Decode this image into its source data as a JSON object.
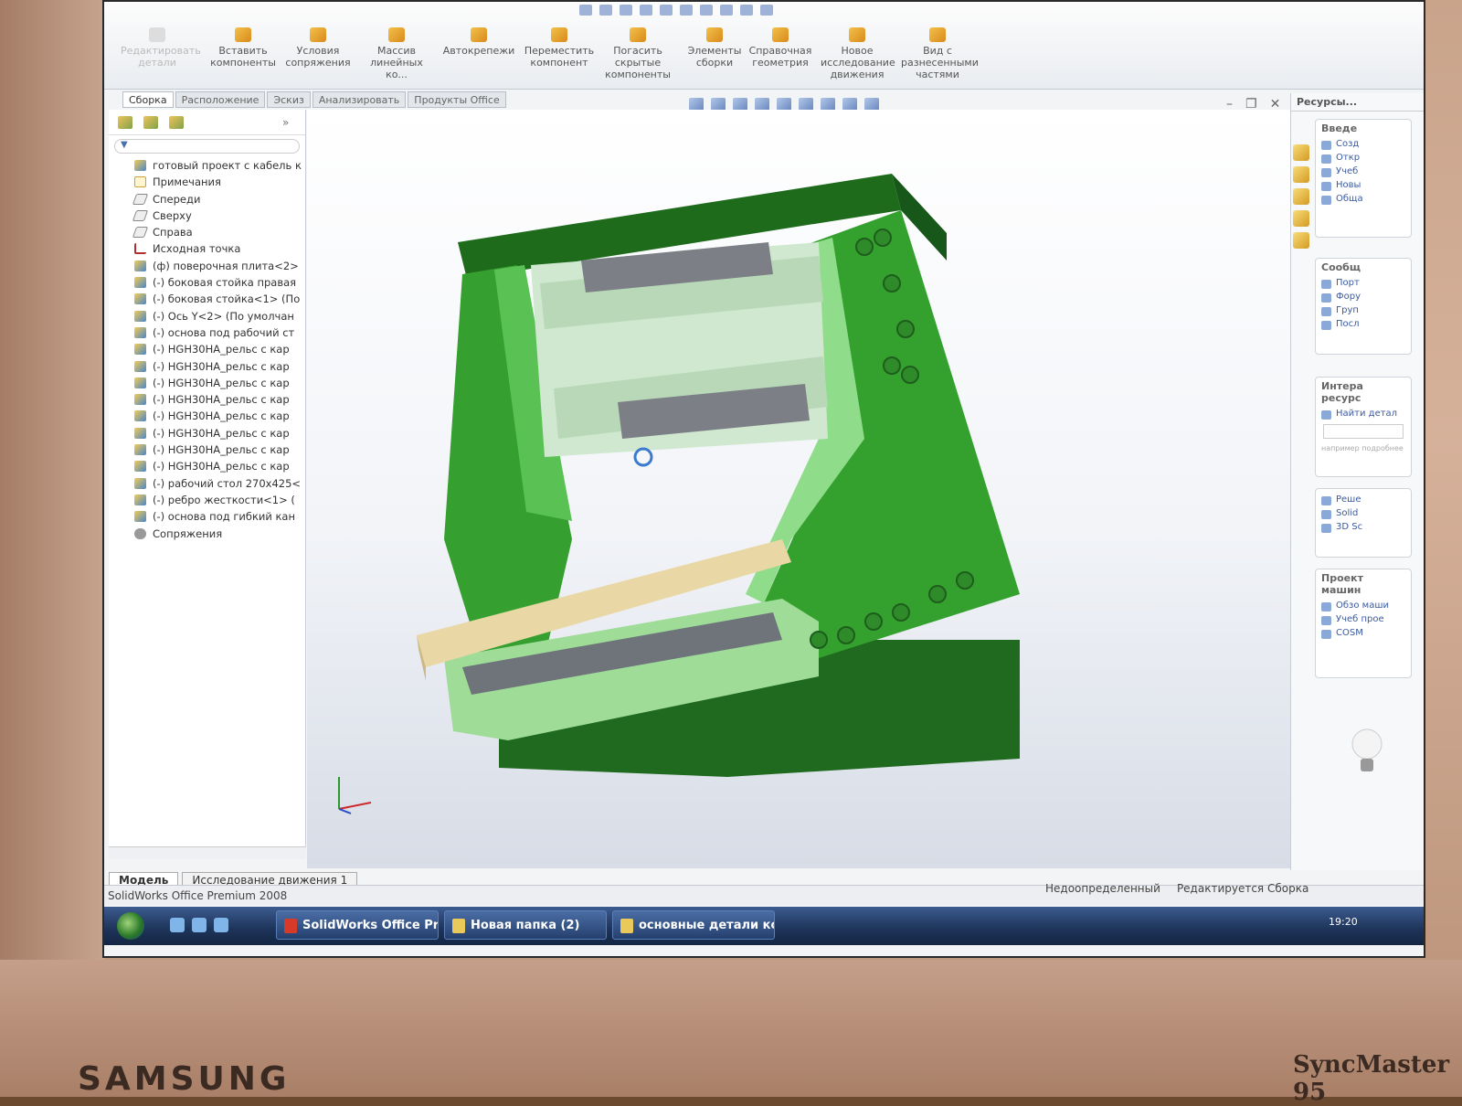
{
  "monitor": {
    "brand": "SAMSUNG",
    "model": "SyncMaster 95"
  },
  "ribbon": {
    "buttons": [
      {
        "label": "Редактировать детали",
        "dim": true
      },
      {
        "label": "Вставить компоненты"
      },
      {
        "label": "Условия сопряжения"
      },
      {
        "label": "Массив линейных ко..."
      },
      {
        "label": "Автокрепежи"
      },
      {
        "label": "Переместить компонент"
      },
      {
        "label": "Погасить скрытые компоненты"
      },
      {
        "label": "Элементы сборки"
      },
      {
        "label": "Справочная геометрия"
      },
      {
        "label": "Новое исследование движения"
      },
      {
        "label": "Вид с разнесенными частями"
      }
    ],
    "tabs": [
      "Сборка",
      "Расположение",
      "Эскиз",
      "Анализировать",
      "Продукты Office"
    ]
  },
  "tree": {
    "items": [
      {
        "label": "готовый проект с кабель к",
        "icon": "part"
      },
      {
        "label": "Примечания",
        "icon": "note"
      },
      {
        "label": "Спереди",
        "icon": "plane"
      },
      {
        "label": "Сверху",
        "icon": "plane"
      },
      {
        "label": "Справа",
        "icon": "plane"
      },
      {
        "label": "Исходная точка",
        "icon": "origin"
      },
      {
        "label": "(ф) поверочная плита<2>",
        "icon": "part"
      },
      {
        "label": "(-) боковая стойка правая",
        "icon": "part"
      },
      {
        "label": "(-) боковая стойка<1> (По",
        "icon": "part"
      },
      {
        "label": "(-) Ось Y<2> (По умолчан",
        "icon": "part"
      },
      {
        "label": "(-) основа под рабочий ст",
        "icon": "part"
      },
      {
        "label": "(-) HGH30HA_рельс с кар",
        "icon": "part"
      },
      {
        "label": "(-) HGH30HA_рельс с кар",
        "icon": "part"
      },
      {
        "label": "(-) HGH30HA_рельс с кар",
        "icon": "part"
      },
      {
        "label": "(-) HGH30HA_рельс с кар",
        "icon": "part"
      },
      {
        "label": "(-) HGH30HA_рельс с кар",
        "icon": "part"
      },
      {
        "label": "(-) HGH30HA_рельс с кар",
        "icon": "part"
      },
      {
        "label": "(-) HGH30HA_рельс с кар",
        "icon": "part"
      },
      {
        "label": "(-) HGH30HA_рельс с кар",
        "icon": "part"
      },
      {
        "label": "(-) рабочий стол 270x425<",
        "icon": "part"
      },
      {
        "label": "(-) ребро жесткости<1> (",
        "icon": "part"
      },
      {
        "label": "(-) основа под гибкий кан",
        "icon": "part"
      },
      {
        "label": "Сопряжения",
        "icon": "mate"
      }
    ]
  },
  "bottom_tabs": [
    "Модель",
    "Исследование движения 1"
  ],
  "task_pane": {
    "title": "Ресурсы...",
    "sections": [
      {
        "title": "Введе",
        "items": [
          "Созд",
          "Откр",
          "Учеб",
          "Новы",
          "Обща"
        ]
      },
      {
        "title": "Сообщ",
        "items": [
          "Порт",
          "Фору",
          "Груп",
          "Посл"
        ]
      },
      {
        "title": "Интера ресурс",
        "items": [
          "Найти детал"
        ],
        "note": "например подробнее"
      },
      {
        "title": "",
        "items": [
          "Реше",
          "Solid",
          "3D Sc"
        ]
      },
      {
        "title": "Проект машин",
        "items": [
          "Обзо маши",
          "Учеб прое",
          "COSM"
        ]
      }
    ]
  },
  "status": {
    "app": "SolidWorks Office Premium 2008",
    "state1": "Недоопределенный",
    "state2": "Редактируется Сборка"
  },
  "taskbar": {
    "tasks": [
      "SolidWorks Office Pr...",
      "Новая папка (2)",
      "основные детали ко..."
    ],
    "clock": "19:20"
  },
  "colors": {
    "model_green": "#2f8a2a",
    "model_light": "#8fdc8a",
    "table": "#e9d8a6",
    "rail": "#7c7f86"
  }
}
